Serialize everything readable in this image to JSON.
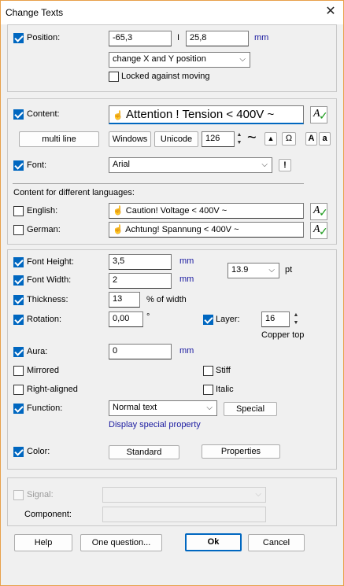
{
  "window": {
    "title": "Change Texts"
  },
  "position": {
    "label": "Position:",
    "x": "-65,3",
    "separator": "I",
    "y": "25,8",
    "unit": "mm",
    "mode": "change X and Y position",
    "locked_label": "Locked against moving"
  },
  "content": {
    "label": "Content:",
    "text": "Attention ! Tension < 400V ~",
    "multiline_label": "multi line",
    "windows_label": "Windows",
    "unicode_label": "Unicode",
    "char_code": "126",
    "tilde": "~",
    "omega": "Ω",
    "upper": "A",
    "lower": "a"
  },
  "font": {
    "label": "Font:",
    "value": "Arial",
    "warn": "!"
  },
  "languages": {
    "header": "Content for different languages:",
    "english_label": "English:",
    "english_text": "Caution! Voltage < 400V ~",
    "german_label": "German:",
    "german_text": "Achtung! Spannung < 400V ~"
  },
  "format": {
    "font_height_label": "Font Height:",
    "font_height": "3,5",
    "font_width_label": "Font Width:",
    "font_width": "2",
    "mm": "mm",
    "pt_value": "13.9",
    "pt_unit": "pt",
    "thickness_label": "Thickness:",
    "thickness": "13",
    "thickness_unit": "% of width",
    "rotation_label": "Rotation:",
    "rotation": "0,00",
    "degree": "°",
    "layer_label": "Layer:",
    "layer_value": "16",
    "layer_name": "Copper top",
    "aura_label": "Aura:",
    "aura": "0",
    "mirrored_label": "Mirrored",
    "stiff_label": "Stiff",
    "right_aligned_label": "Right-aligned",
    "italic_label": "Italic",
    "function_label": "Function:",
    "function_value": "Normal text",
    "special_label": "Special",
    "special_property": "Display special property",
    "color_label": "Color:",
    "color_value": "Standard",
    "properties_label": "Properties"
  },
  "signal": {
    "label": "Signal:",
    "component_label": "Component:"
  },
  "footer": {
    "help": "Help",
    "question": "One question...",
    "ok": "Ok",
    "cancel": "Cancel"
  },
  "colors": {
    "accent": "#0067c0",
    "frame": "#e8a04a",
    "unit_text": "#1a1aa0"
  }
}
